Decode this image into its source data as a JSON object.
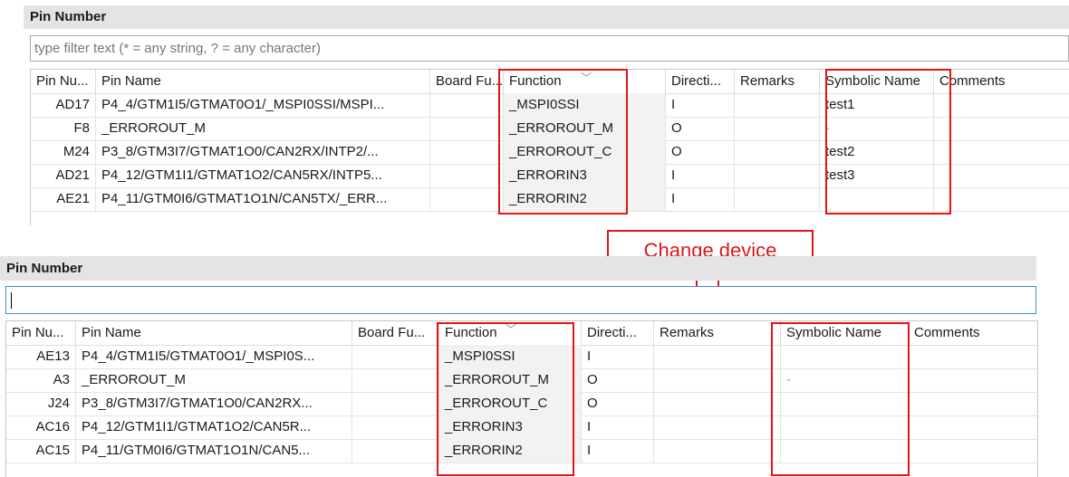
{
  "panel1": {
    "title": "Pin Number",
    "filter_placeholder": "type filter text (* = any string, ? = any character)",
    "columns": [
      "Pin Nu...",
      "Pin Name",
      "Board Fu...",
      "Function",
      "Directi...",
      "Remarks",
      "Symbolic Name",
      "Comments"
    ],
    "rows": [
      {
        "pin": "AD17",
        "name": "P4_4/GTM1I5/GTMAT0O1/_MSPI0SSI/MSPI...",
        "board": "",
        "func": "_MSPI0SSI",
        "dir": "I",
        "remarks": "",
        "sym": "test1",
        "comments": ""
      },
      {
        "pin": "F8",
        "name": "_ERROROUT_M",
        "board": "",
        "func": "_ERROROUT_M",
        "dir": "O",
        "remarks": "",
        "sym": "-",
        "comments": ""
      },
      {
        "pin": "M24",
        "name": "P3_8/GTM3I7/GTMAT1O0/CAN2RX/INTP2/...",
        "board": "",
        "func": "_ERROROUT_C",
        "dir": "O",
        "remarks": "",
        "sym": "test2",
        "comments": ""
      },
      {
        "pin": "AD21",
        "name": "P4_12/GTM1I1/GTMAT1O2/CAN5RX/INTP5...",
        "board": "",
        "func": "_ERRORIN3",
        "dir": "I",
        "remarks": "",
        "sym": "test3",
        "comments": ""
      },
      {
        "pin": "AE21",
        "name": "P4_11/GTM0I6/GTMAT1O1N/CAN5TX/_ERR...",
        "board": "",
        "func": "_ERRORIN2",
        "dir": "I",
        "remarks": "",
        "sym": "",
        "comments": ""
      }
    ]
  },
  "callout": {
    "label": "Change device"
  },
  "panel2": {
    "title": "Pin Number",
    "filter_value": "",
    "columns": [
      "Pin Nu...",
      "Pin Name",
      "Board Fu...",
      "Function",
      "Directi...",
      "Remarks",
      "Symbolic Name",
      "Comments"
    ],
    "rows": [
      {
        "pin": "AE13",
        "name": "P4_4/GTM1I5/GTMAT0O1/_MSPI0S...",
        "board": "",
        "func": "_MSPI0SSI",
        "dir": "I",
        "remarks": "",
        "sym": "",
        "comments": ""
      },
      {
        "pin": "A3",
        "name": "_ERROROUT_M",
        "board": "",
        "func": "_ERROROUT_M",
        "dir": "O",
        "remarks": "",
        "sym": "-",
        "comments": ""
      },
      {
        "pin": "J24",
        "name": "P3_8/GTM3I7/GTMAT1O0/CAN2RX...",
        "board": "",
        "func": "_ERROROUT_C",
        "dir": "O",
        "remarks": "",
        "sym": "",
        "comments": ""
      },
      {
        "pin": "AC16",
        "name": "P4_12/GTM1I1/GTMAT1O2/CAN5R...",
        "board": "",
        "func": "_ERRORIN3",
        "dir": "I",
        "remarks": "",
        "sym": "",
        "comments": ""
      },
      {
        "pin": "AC15",
        "name": "P4_11/GTM0I6/GTMAT1O1N/CAN5...",
        "board": "",
        "func": "_ERRORIN2",
        "dir": "I",
        "remarks": "",
        "sym": "",
        "comments": ""
      }
    ]
  },
  "colors": {
    "highlight": "#e0161a",
    "title_bg": "#e4e4e4",
    "focus_border": "#3b8fd6"
  },
  "icons": {
    "sort_indicator": "chevron-down-icon",
    "callout_arrow": "down-arrow-icon"
  }
}
